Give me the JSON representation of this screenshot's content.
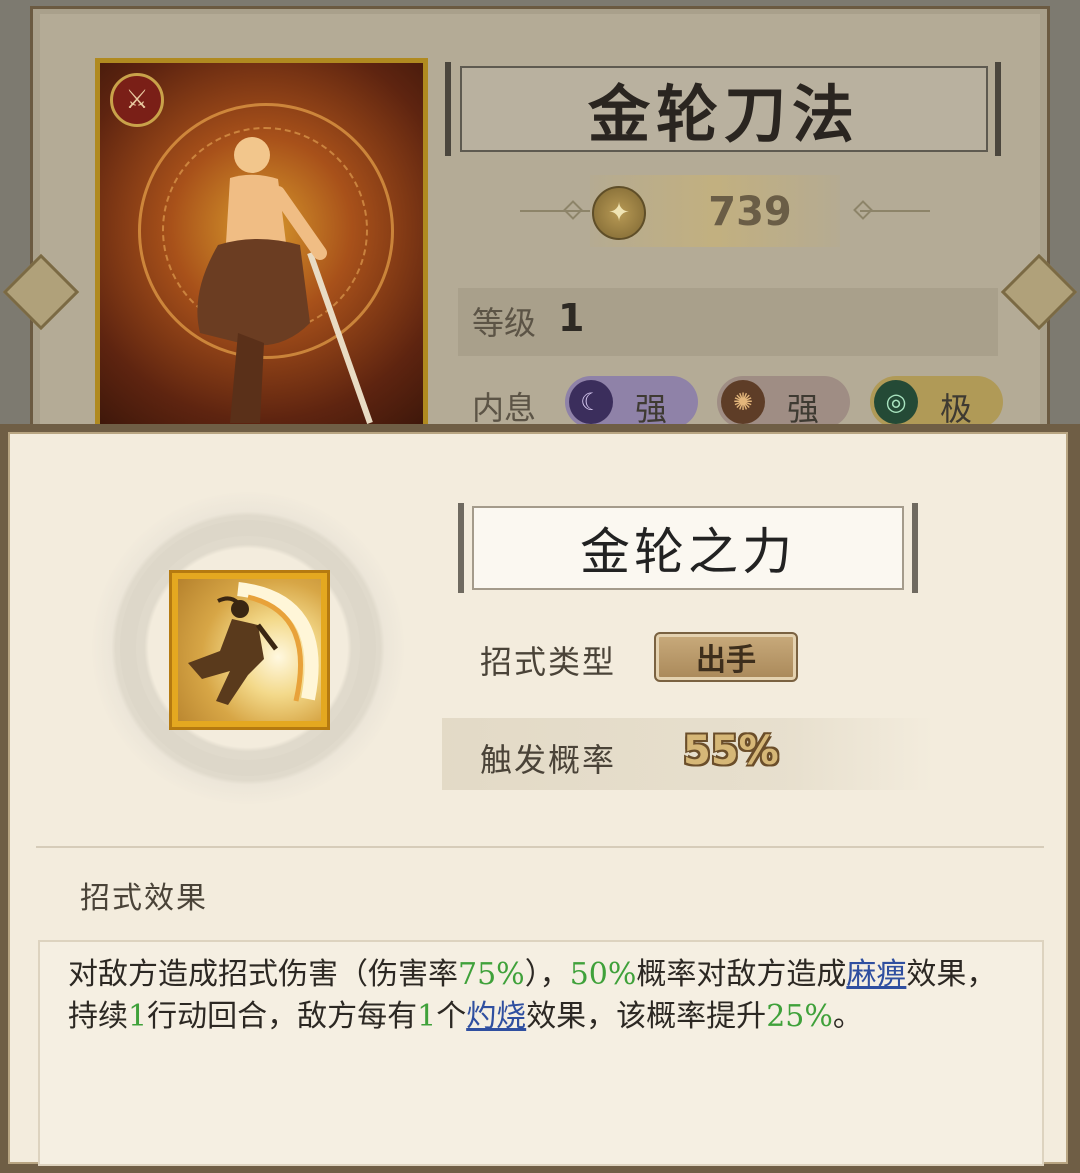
{
  "background_card": {
    "name": "金轮刀法",
    "power": "739",
    "level_label": "等级",
    "level_value": "1",
    "neixi_label": "内息",
    "neixi_tags": [
      "强",
      "强",
      "极"
    ]
  },
  "skill": {
    "name": "金轮之力",
    "type_label": "招式类型",
    "type_value": "出手",
    "rate_label": "触发概率",
    "rate_value": "55%"
  },
  "effect": {
    "heading": "招式效果",
    "segments": [
      {
        "text": "对敌方造成招式伤害（伤害率",
        "style": "normal"
      },
      {
        "text": "75%",
        "style": "number"
      },
      {
        "text": "），",
        "style": "normal"
      },
      {
        "text": "50%",
        "style": "number"
      },
      {
        "text": "概率对敌方造成",
        "style": "normal"
      },
      {
        "text": "麻痹",
        "style": "link"
      },
      {
        "text": "效果，持续",
        "style": "normal"
      },
      {
        "text": "1",
        "style": "number"
      },
      {
        "text": "行动回合，敌方每有",
        "style": "normal"
      },
      {
        "text": "1",
        "style": "number"
      },
      {
        "text": "个",
        "style": "normal"
      },
      {
        "text": "灼烧",
        "style": "link"
      },
      {
        "text": "效果，该概率提升",
        "style": "normal"
      },
      {
        "text": "25%",
        "style": "number"
      },
      {
        "text": "。",
        "style": "normal"
      }
    ]
  },
  "colors": {
    "number_highlight": "#3fa13a",
    "keyword_link": "#2f4fa0",
    "rate_value": "#d6b777"
  },
  "icons": {
    "card_badge": "sword-emblem-icon",
    "power": "sword-medal-icon",
    "neixi": [
      "moon-icon",
      "sun-icon",
      "jade-ring-icon"
    ],
    "skill": "golden-blade-dancer-icon"
  }
}
